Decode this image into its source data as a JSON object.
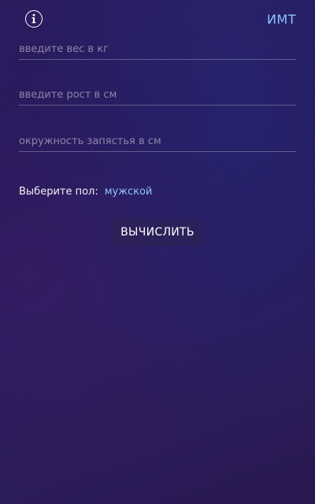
{
  "header": {
    "title": "ИМТ",
    "info_icon": "info-icon"
  },
  "form": {
    "weight": {
      "value": "",
      "placeholder": "введите вес в кг"
    },
    "height": {
      "value": "",
      "placeholder": "введите рост в см"
    },
    "wrist": {
      "value": "",
      "placeholder": "окружность запястья в см"
    }
  },
  "gender": {
    "label": "Выберите пол:",
    "selected": "мужской"
  },
  "calculate_label": "ВЫЧИСЛИТЬ",
  "colors": {
    "accent": "#8cc6ff",
    "background": "#24195a",
    "text": "#ffffff"
  }
}
